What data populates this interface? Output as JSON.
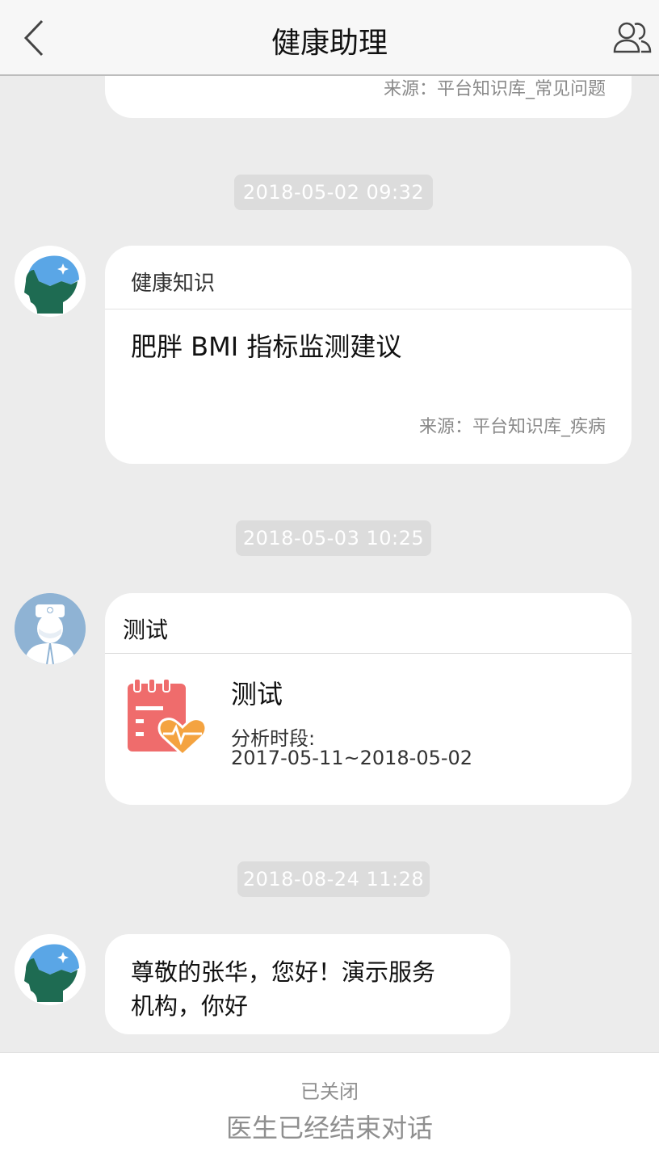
{
  "nav": {
    "title": "健康助理",
    "back_icon": "chevron-left-icon",
    "contacts_icon": "people-icon"
  },
  "feed": {
    "partial_card": {
      "source": "来源：平台知识库_常见问题"
    },
    "timestamps": [
      "2018-05-02 09:32",
      "2018-05-03 10:25",
      "2018-08-24 11:28"
    ],
    "knowledge_card": {
      "header": "健康知识",
      "headline": "肥胖 BMI 指标监测建议",
      "source": "来源：平台知识库_疾病"
    },
    "report_card": {
      "header": "测试",
      "report_title": "测试",
      "period_label": "分析时段:",
      "period_value": "2017-05-11~2018-05-02",
      "icon": "health-report-icon"
    },
    "text_message": {
      "line1": "尊敬的张华，您好！演示服务",
      "line2": "机构，你好"
    }
  },
  "footer": {
    "status": "已关闭",
    "message": "医生已经结束对话"
  },
  "colors": {
    "background": "#ececec",
    "nav_bg": "#f7f7f7",
    "card_bg": "#ffffff",
    "muted_text": "#8a8a8a",
    "report_red": "#ef6c6c",
    "report_orange": "#f4a340"
  }
}
